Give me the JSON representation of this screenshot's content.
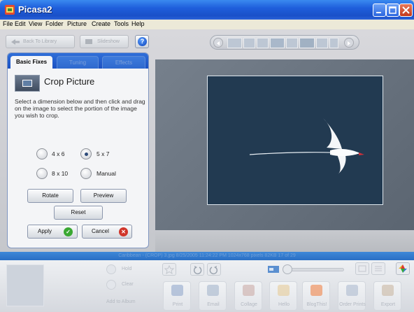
{
  "window": {
    "title": "Picasa2"
  },
  "menu": [
    "File",
    "Edit",
    "View",
    "Folder",
    "Picture",
    "Create",
    "Tools",
    "Help"
  ],
  "toolbar": {
    "back_label": "Back To Library",
    "slideshow_label": "Slideshow",
    "help_label": "?"
  },
  "tabs": [
    {
      "label": "Basic Fixes",
      "active": true
    },
    {
      "label": "Tuning",
      "active": false
    },
    {
      "label": "Effects",
      "active": false
    }
  ],
  "crop": {
    "title": "Crop Picture",
    "instructions": "Select a dimension below and then click and drag on the image to select the portion of the image you wish to crop.",
    "options": [
      {
        "label": "4 x 6",
        "selected": false
      },
      {
        "label": "5 x 7",
        "selected": true
      },
      {
        "label": "8 x 10",
        "selected": false
      },
      {
        "label": "Manual",
        "selected": false
      }
    ],
    "rotate_label": "Rotate",
    "preview_label": "Preview",
    "reset_label": "Reset",
    "apply_label": "Apply",
    "cancel_label": "Cancel"
  },
  "status": {
    "text": "Caribbean - (CROP) 3.jpg   8/25/2005 11:24:22 PM   1024x768 pixels   82KB   17 of 29"
  },
  "tray": {
    "hold_label": "Hold",
    "clear_label": "Clear",
    "add_label": "Add to Album",
    "actions": [
      {
        "label": "Print",
        "icon": "printer-icon",
        "color": "#8aa2c8"
      },
      {
        "label": "Email",
        "icon": "email-icon",
        "color": "#9fb0c8"
      },
      {
        "label": "Collage",
        "icon": "collage-icon",
        "color": "#c8a6a0"
      },
      {
        "label": "Hello",
        "icon": "hello-icon",
        "color": "#e6c890"
      },
      {
        "label": "BlogThis!",
        "icon": "blogger-icon",
        "color": "#f07a38"
      },
      {
        "label": "Order Prints",
        "icon": "order-prints-icon",
        "color": "#a8b6cc"
      },
      {
        "label": "Export",
        "icon": "export-icon",
        "color": "#c6b39a"
      }
    ]
  },
  "colors": {
    "accent": "#1f5fdc",
    "apply_check": "#3aa832",
    "cancel_x": "#d0352a"
  }
}
